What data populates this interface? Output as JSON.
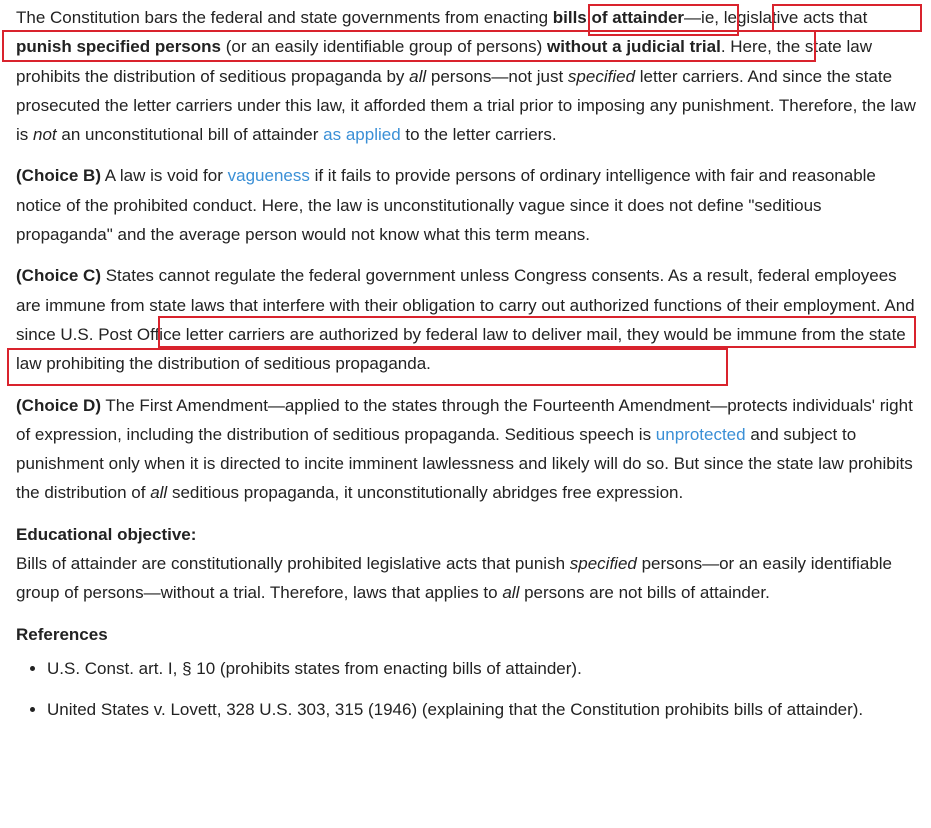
{
  "para1": {
    "t1": "The Constitution bars the federal and state governments from enacting ",
    "b1": "bills of attainder",
    "t2": "—ie, legislative acts that ",
    "b2": "punish specified persons",
    "t3": " (or an easily identifiable group of persons) ",
    "b3": "without a judicial trial",
    "t4": ".  Here, the state law prohibits the distribution of seditious propaganda by ",
    "i1": "all",
    "t5": " persons—not just ",
    "i2": "specified",
    "t6": " letter carriers.  And since the state prosecuted the letter carriers under this law, it afforded them a trial prior to imposing any punishment.  Therefore, the law is ",
    "i3": "not",
    "t7": " an unconstitutional bill of attainder ",
    "link": "as applied",
    "t8": " to the letter carriers."
  },
  "choice_b": {
    "label": "(Choice B)",
    "t1": "  A law is void for ",
    "link": "vagueness",
    "t2": " if it fails to provide persons of ordinary intelligence with fair and reasonable notice of the prohibited conduct.  Here, the law is unconstitutionally vague since it does not define \"seditious propaganda\" and the average person would not know what this term means."
  },
  "choice_c": {
    "label": "(Choice C)",
    "t1": "  States cannot regulate the federal government unless Congress consents.  As a result, federal employees are immune from state laws that interfere with their obligation to carry out authorized functions of their employment.  And since U.S. Post Office letter carriers are authorized by federal law to deliver mail, they would be immune from the state law prohibiting the distribution of seditious propaganda."
  },
  "choice_d": {
    "label": "(Choice D)",
    "t1": "  The First Amendment—applied to the states through the Fourteenth Amendment—protects individuals' right of expression, including the distribution of seditious propaganda.  Seditious speech is ",
    "link": "unprotected",
    "t2": " and subject to punishment only when it is directed to incite imminent lawlessness and likely will do so.  But since the state law prohibits the distribution of ",
    "i1": "all",
    "t3": " seditious propaganda, it unconstitutionally abridges free expression."
  },
  "objective": {
    "heading": "Educational objective:",
    "t1": "Bills of attainder are constitutionally prohibited legislative acts that punish ",
    "i1": "specified",
    "t2": " persons—or an easily identifiable group of persons—without a trial.  Therefore, laws that applies to ",
    "i2": "all",
    "t3": " persons are not bills of attainder."
  },
  "references": {
    "heading": "References",
    "items": [
      "U.S. Const. art. I, § 10 (prohibits states from enacting bills of attainder).",
      "United States v. Lovett, 328 U.S. 303, 315 (1946) (explaining that the Constitution prohibits bills of attainder)."
    ]
  },
  "highlight_color": "#d9232d",
  "link_color": "#3a8fd6"
}
